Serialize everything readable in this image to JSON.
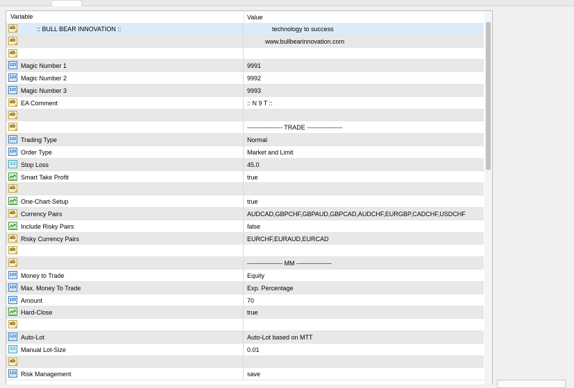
{
  "header": {
    "variable": "Variable",
    "value": "Value"
  },
  "rows": [
    {
      "type": "string",
      "icon": "abc-string-icon",
      "name": ":: BULL BEAR INNOVATION ::",
      "value": "technology to success",
      "style": "sel"
    },
    {
      "type": "string",
      "icon": "abc-string-icon",
      "name": "",
      "value": "www.bullbearinnovation.com",
      "style": "shade"
    },
    {
      "type": "string",
      "icon": "abc-string-icon",
      "name": "",
      "value": "",
      "style": ""
    },
    {
      "type": "int",
      "icon": "int-123-icon",
      "name": "Magic Number 1",
      "value": "9991",
      "style": "shade"
    },
    {
      "type": "int",
      "icon": "int-123-icon",
      "name": "Magic Number 2",
      "value": "9992",
      "style": ""
    },
    {
      "type": "int",
      "icon": "int-123-icon",
      "name": "Magic Number 3",
      "value": "9993",
      "style": "shade"
    },
    {
      "type": "string",
      "icon": "abc-string-icon",
      "name": "EA Comment",
      "value": ":: N 9 T ::",
      "style": ""
    },
    {
      "type": "string",
      "icon": "abc-string-icon",
      "name": "",
      "value": "",
      "style": "shade"
    },
    {
      "type": "string",
      "icon": "abc-string-icon",
      "name": "",
      "value": "----------------- TRADE -----------------",
      "style": ""
    },
    {
      "type": "int",
      "icon": "int-123-icon",
      "name": "Trading Type",
      "value": "Normal",
      "style": "shade"
    },
    {
      "type": "int",
      "icon": "int-123-icon",
      "name": "Order Type",
      "value": "Market and Limit",
      "style": ""
    },
    {
      "type": "double",
      "icon": "double-icon",
      "name": "Stop Loss",
      "value": "45.0",
      "style": "shade"
    },
    {
      "type": "bool",
      "icon": "bool-toggle-icon",
      "name": "Smart Take Profit",
      "value": "true",
      "style": ""
    },
    {
      "type": "string",
      "icon": "abc-string-icon",
      "name": "",
      "value": "",
      "style": "shade"
    },
    {
      "type": "bool",
      "icon": "bool-toggle-icon",
      "name": "One-Chart-Setup",
      "value": "true",
      "style": ""
    },
    {
      "type": "string",
      "icon": "abc-string-icon",
      "name": "Currency Pairs",
      "value": "AUDCAD,GBPCHF,GBPAUD,GBPCAD,AUDCHF,EURGBP,CADCHF,USDCHF",
      "style": "shade"
    },
    {
      "type": "bool",
      "icon": "bool-toggle-icon",
      "name": "Include Risky Pairs",
      "value": "false",
      "style": ""
    },
    {
      "type": "string",
      "icon": "abc-string-icon",
      "name": "Risky Currency Pairs",
      "value": "EURCHF,EURAUD,EURCAD",
      "style": "shade"
    },
    {
      "type": "string",
      "icon": "abc-string-icon",
      "name": "",
      "value": "",
      "style": ""
    },
    {
      "type": "string",
      "icon": "abc-string-icon",
      "name": "",
      "value": "----------------- MM -----------------",
      "style": "shade"
    },
    {
      "type": "int",
      "icon": "int-123-icon",
      "name": "Money to Trade",
      "value": "Equity",
      "style": ""
    },
    {
      "type": "int",
      "icon": "int-123-icon",
      "name": "Max. Money To Trade",
      "value": "Exp. Percentage",
      "style": "shade"
    },
    {
      "type": "int",
      "icon": "int-123-icon",
      "name": "Amount",
      "value": "70",
      "style": ""
    },
    {
      "type": "bool",
      "icon": "bool-toggle-icon",
      "name": "Hard-Close",
      "value": "true",
      "style": "shade"
    },
    {
      "type": "string",
      "icon": "abc-string-icon",
      "name": "",
      "value": "",
      "style": ""
    },
    {
      "type": "int",
      "icon": "int-123-icon",
      "name": "Auto-Lot",
      "value": "Auto-Lot based on MTT",
      "style": "shade"
    },
    {
      "type": "double",
      "icon": "double-icon",
      "name": "Manual Lot-Size",
      "value": "0.01",
      "style": ""
    },
    {
      "type": "string",
      "icon": "abc-string-icon",
      "name": "",
      "value": "",
      "style": "shade"
    },
    {
      "type": "int",
      "icon": "int-123-icon",
      "name": "Risk Management",
      "value": "save",
      "style": ""
    }
  ],
  "icon_glyphs": {
    "string": "ab",
    "int": "123",
    "double": "1/2"
  },
  "colors": {
    "selected_row": "#dcebf9",
    "shaded_row": "#e8e8e8",
    "grid_border": "#bdbdbd"
  }
}
